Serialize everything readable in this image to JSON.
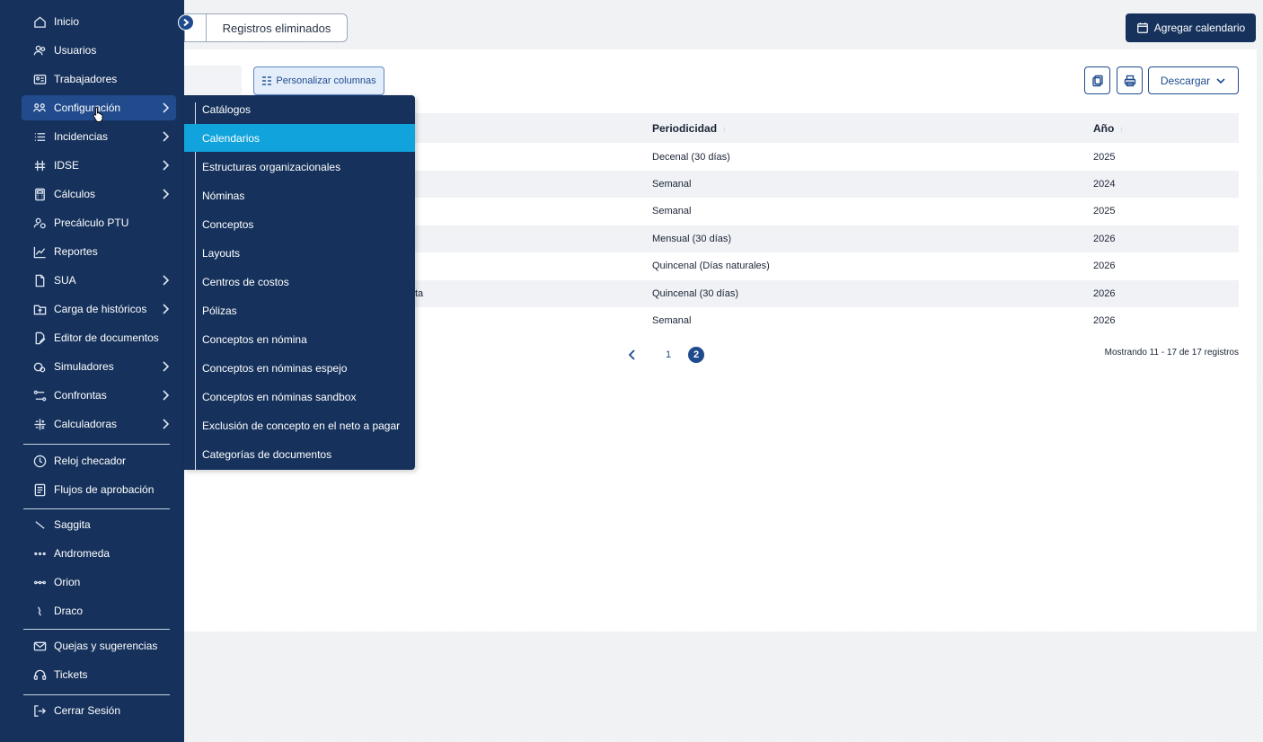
{
  "sidebar": {
    "items": [
      {
        "label": "Inicio",
        "icon": "home-icon"
      },
      {
        "label": "Usuarios",
        "icon": "users-icon"
      },
      {
        "label": "Trabajadores",
        "icon": "id-card-icon"
      },
      {
        "label": "Configuración",
        "icon": "config-icon",
        "active": true
      },
      {
        "label": "Incidencias",
        "icon": "list-icon"
      },
      {
        "label": "IDSE",
        "icon": "transfer-icon"
      },
      {
        "label": "Cálculos",
        "icon": "calculator-icon"
      },
      {
        "label": "Precálculo PTU",
        "icon": "ptu-icon"
      },
      {
        "label": "Reportes",
        "icon": "chart-line-icon"
      },
      {
        "label": "SUA",
        "icon": "document-icon"
      },
      {
        "label": "Carga de históricos",
        "icon": "upload-folder-icon"
      },
      {
        "label": "Editor de documentos",
        "icon": "edit-document-icon"
      },
      {
        "label": "Simuladores",
        "icon": "simulator-icon"
      },
      {
        "label": "Confrontas",
        "icon": "compare-icon"
      },
      {
        "label": "Calculadoras",
        "icon": "calculator-grid-icon"
      },
      {
        "label": "Reloj checador",
        "icon": "clock-icon"
      },
      {
        "label": "Flujos de aprobación",
        "icon": "approval-icon"
      },
      {
        "label": "Saggita",
        "icon": "saggita-icon"
      },
      {
        "label": "Andromeda",
        "icon": "andromeda-icon"
      },
      {
        "label": "Orion",
        "icon": "orion-icon"
      },
      {
        "label": "Draco",
        "icon": "draco-icon"
      },
      {
        "label": "Quejas y sugerencias",
        "icon": "feedback-icon"
      },
      {
        "label": "Tickets",
        "icon": "headset-icon"
      },
      {
        "label": "Cerrar Sesión",
        "icon": "logout-icon"
      }
    ]
  },
  "submenu": {
    "items": [
      "Catálogos",
      "Calendarios",
      "Estructuras organizacionales",
      "Nóminas",
      "Conceptos",
      "Layouts",
      "Centros de costos",
      "Pólizas",
      "Conceptos en nómina",
      "Conceptos en nóminas espejo",
      "Conceptos en nóminas sandbox",
      "Exclusión de concepto en el neto a pagar",
      "Categorías de documentos"
    ],
    "active_index": 1
  },
  "tabs": {
    "second_label": "Registros eliminados"
  },
  "toolbar": {
    "add_label": "Agregar calendario",
    "columns_label": "Personalizar columnas",
    "download_label": "Descargar"
  },
  "table": {
    "headers": {
      "periodicidad": "Periodicidad",
      "anio": "Año"
    },
    "rows": [
      {
        "prefix": "",
        "periodicidad": "Decenal (30 días)",
        "anio": "2025"
      },
      {
        "prefix": "",
        "periodicidad": "Semanal",
        "anio": "2024"
      },
      {
        "prefix": "",
        "periodicidad": "Semanal",
        "anio": "2025"
      },
      {
        "prefix": "",
        "periodicidad": "Mensual (30 días)",
        "anio": "2026"
      },
      {
        "prefix": "",
        "periodicidad": "Quincenal (Días naturales)",
        "anio": "2026"
      },
      {
        "prefix": "ta",
        "periodicidad": "Quincenal (30 días)",
        "anio": "2026"
      },
      {
        "prefix": "",
        "periodicidad": "Semanal",
        "anio": "2026"
      }
    ]
  },
  "pagination": {
    "pages": [
      "1",
      "2"
    ],
    "current": "2",
    "showing": "Mostrando 11 - 17 de 17 registros"
  },
  "colors": {
    "sidebar": "#16325c",
    "accent": "#10a3dc",
    "primary": "#1f4b8e"
  }
}
